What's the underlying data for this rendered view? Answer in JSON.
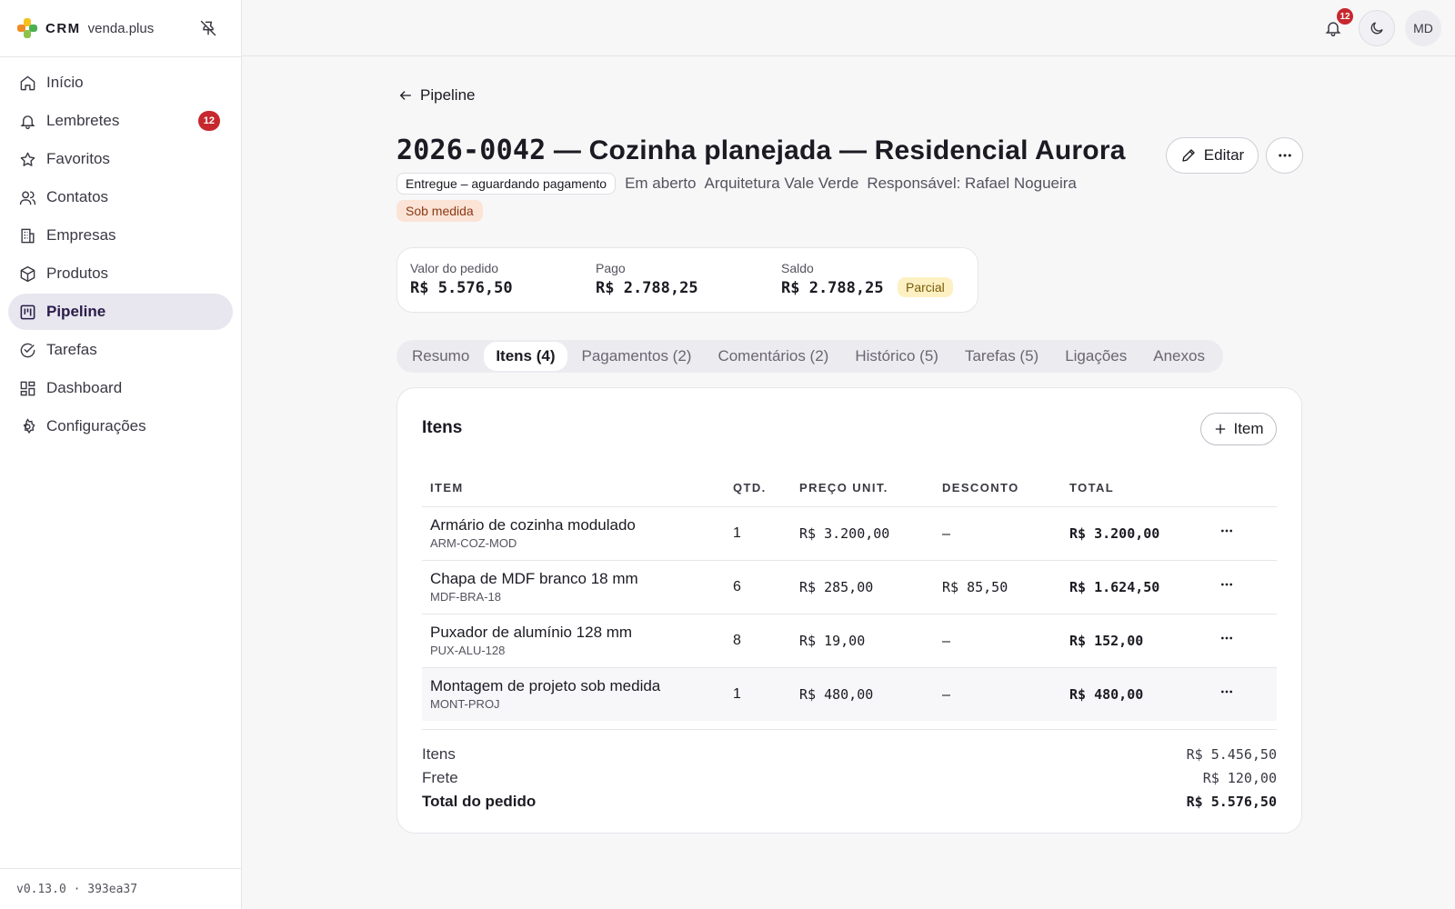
{
  "brand": {
    "crm": "CRM",
    "name": "venda.plus"
  },
  "sidebar": {
    "items": [
      {
        "label": "Início",
        "icon": "home-icon"
      },
      {
        "label": "Lembretes",
        "icon": "bell-icon",
        "badge": "12"
      },
      {
        "label": "Favoritos",
        "icon": "star-icon"
      },
      {
        "label": "Contatos",
        "icon": "users-icon"
      },
      {
        "label": "Empresas",
        "icon": "building-icon"
      },
      {
        "label": "Produtos",
        "icon": "package-icon"
      },
      {
        "label": "Pipeline",
        "icon": "kanban-icon",
        "active": true
      },
      {
        "label": "Tarefas",
        "icon": "check-circle-icon"
      },
      {
        "label": "Dashboard",
        "icon": "dashboard-icon"
      },
      {
        "label": "Configurações",
        "icon": "gear-icon"
      }
    ],
    "version": "v0.13.0 · 393ea37"
  },
  "topbar": {
    "notifications": "12",
    "avatar": "MD"
  },
  "page": {
    "back_label": "Pipeline",
    "code": "2026-0042",
    "title_rest": " — Cozinha planejada — Residencial Aurora",
    "status": "Entregue – aguardando pagamento",
    "state": "Em aberto",
    "company": "Arquitetura Vale Verde",
    "owner": "Responsável: Rafael Nogueira",
    "tag": "Sob medida",
    "edit_label": "Editar"
  },
  "summary": {
    "order_label": "Valor do pedido",
    "order_value": "R$ 5.576,50",
    "paid_label": "Pago",
    "paid_value": "R$ 2.788,25",
    "balance_label": "Saldo",
    "balance_value": "R$ 2.788,25",
    "balance_badge": "Parcial"
  },
  "tabs": [
    "Resumo",
    "Itens (4)",
    "Pagamentos (2)",
    "Comentários (2)",
    "Histórico (5)",
    "Tarefas (5)",
    "Ligações",
    "Anexos"
  ],
  "active_tab": 1,
  "items_card": {
    "title": "Itens",
    "add_label": "Item",
    "columns": [
      "ITEM",
      "QTD.",
      "PREÇO UNIT.",
      "DESCONTO",
      "TOTAL"
    ],
    "rows": [
      {
        "name": "Armário de cozinha modulado",
        "sku": "ARM-COZ-MOD",
        "qty": "1",
        "price": "R$ 3.200,00",
        "discount": "—",
        "total": "R$ 3.200,00"
      },
      {
        "name": "Chapa de MDF branco 18 mm",
        "sku": "MDF-BRA-18",
        "qty": "6",
        "price": "R$ 285,00",
        "discount": "R$ 85,50",
        "total": "R$ 1.624,50"
      },
      {
        "name": "Puxador de alumínio 128 mm",
        "sku": "PUX-ALU-128",
        "qty": "8",
        "price": "R$ 19,00",
        "discount": "—",
        "total": "R$ 152,00"
      },
      {
        "name": "Montagem de projeto sob medida",
        "sku": "MONT-PROJ",
        "qty": "1",
        "price": "R$ 480,00",
        "discount": "—",
        "total": "R$ 480,00"
      }
    ],
    "totals": {
      "items_label": "Itens",
      "items_value": "R$ 5.456,50",
      "freight_label": "Frete",
      "freight_value": "R$ 120,00",
      "total_label": "Total do pedido",
      "total_value": "R$ 5.576,50"
    }
  },
  "colors": {
    "accent": "#2a1d4a",
    "badge": "#c6282e",
    "tag_bg": "#fbe3d6",
    "partial_bg": "#fdf1c4"
  }
}
